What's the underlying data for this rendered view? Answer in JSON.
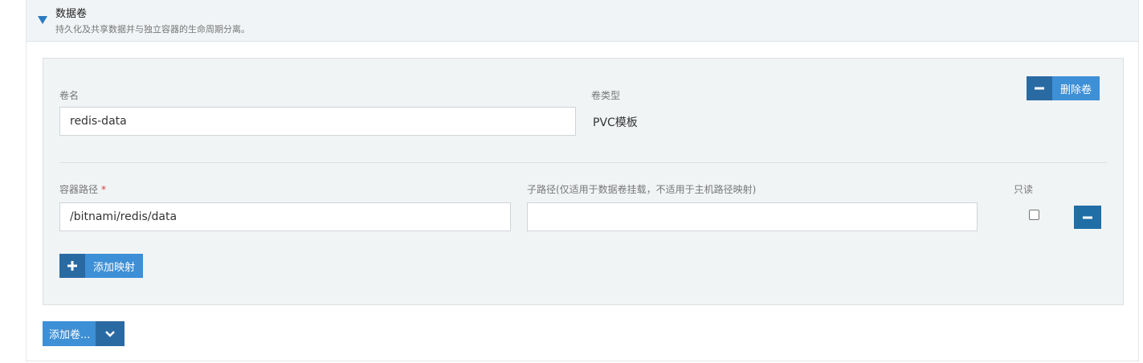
{
  "section": {
    "title": "数据卷",
    "subtitle": "持久化及共享数据并与独立容器的生命周期分离。",
    "caret_icon": "triangle-down-icon"
  },
  "volume": {
    "name_label": "卷名",
    "name_value": "redis-data",
    "type_label": "卷类型",
    "type_value": "PVC模板",
    "remove_label": "删除卷"
  },
  "mapping": {
    "container_path_label": "容器路径",
    "required_mark": "*",
    "container_path_value": "/bitnami/redis/data",
    "subpath_label": "子路径(仅适用于数据卷挂载，不适用于主机路径映射)",
    "subpath_value": "",
    "readonly_label": "只读",
    "readonly_checked": false,
    "add_mapping_label": "添加映射"
  },
  "footer": {
    "add_volume_label": "添加卷..."
  },
  "colors": {
    "primary": "#3d8fd6",
    "primary_dark": "#2a6aa3",
    "panel_bg": "#f1f4f5",
    "required": "#e0393e"
  }
}
